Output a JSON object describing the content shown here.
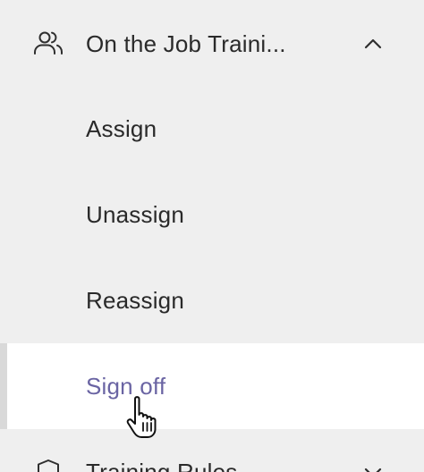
{
  "nav": {
    "section": {
      "label": "On the Job Traini...",
      "icon": "users-icon",
      "chevron": "chevron-up-icon",
      "expanded": true
    },
    "items": [
      {
        "label": "Assign",
        "active": false
      },
      {
        "label": "Unassign",
        "active": false
      },
      {
        "label": "Reassign",
        "active": false
      },
      {
        "label": "Sign off",
        "active": true
      }
    ],
    "next_section": {
      "label": "Training Rules",
      "icon": "shield-icon",
      "chevron": "chevron-down-icon",
      "expanded": false
    }
  },
  "colors": {
    "sidebar_bg": "#efefef",
    "active_bg": "#ffffff",
    "active_text": "#6a64a3",
    "active_indicator": "#d9d9d9",
    "text": "#2a2a2a"
  },
  "cursor": {
    "type": "hand-pointer-icon"
  }
}
